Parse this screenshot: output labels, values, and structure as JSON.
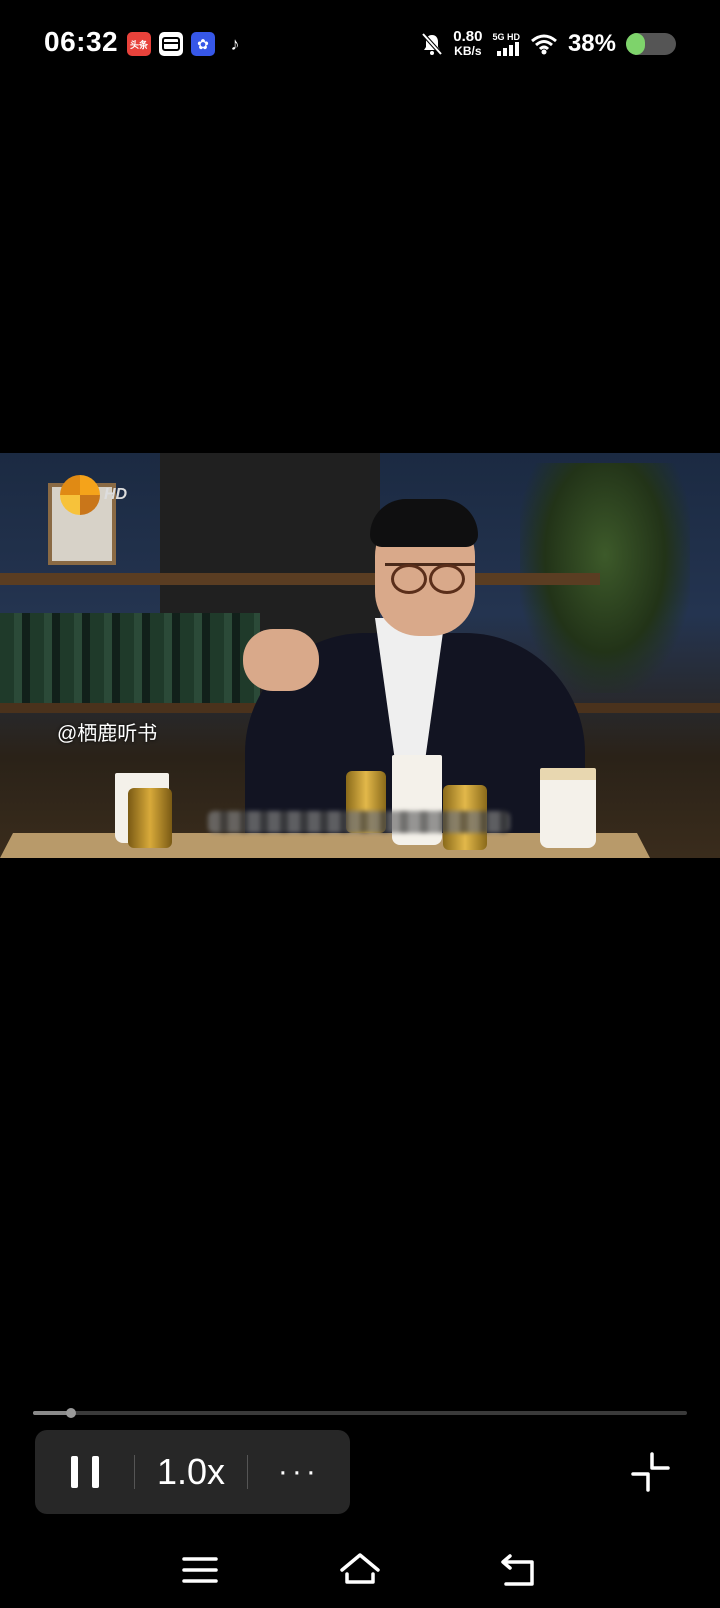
{
  "status_bar": {
    "time": "06:32",
    "notification_icons": [
      "toutiao-icon",
      "card-icon",
      "blue-app-icon",
      "tiktok-icon"
    ],
    "toutiao_label": "头条",
    "net_speed_value": "0.80",
    "net_speed_unit": "KB/s",
    "signal_label": "5G HD",
    "battery_percent_text": "38%",
    "battery_level": 0.38,
    "colors": {
      "battery_fill": "#7ed36b"
    }
  },
  "video": {
    "channel_logo_text": "HD",
    "watermark": "@栖鹿听书"
  },
  "player": {
    "progress": 0.058,
    "pause_icon": "pause-icon",
    "speed_label": "1.0x",
    "more_label": "···",
    "exit_fullscreen_icon": "exit-fullscreen-icon"
  },
  "navbar": {
    "icons": [
      "menu-icon",
      "home-icon",
      "back-icon"
    ]
  }
}
